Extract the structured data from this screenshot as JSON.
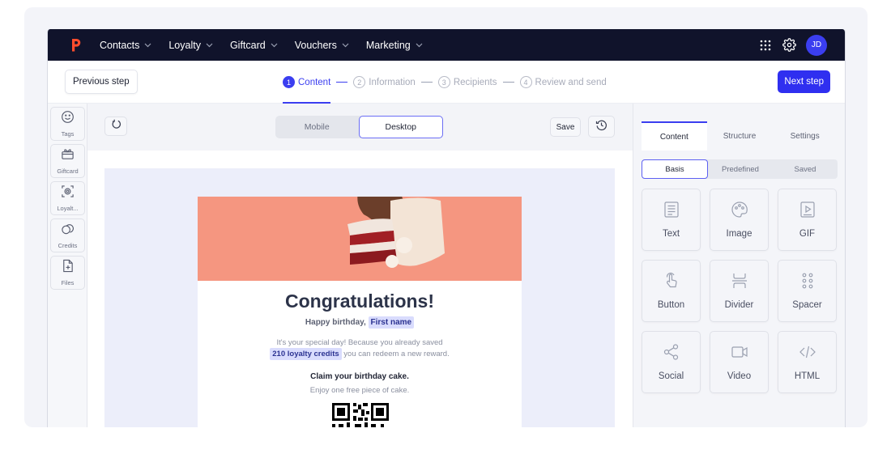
{
  "nav": {
    "items": [
      {
        "label": "Contacts"
      },
      {
        "label": "Loyalty"
      },
      {
        "label": "Giftcard"
      },
      {
        "label": "Vouchers"
      },
      {
        "label": "Marketing"
      }
    ],
    "avatar": "JD"
  },
  "stepbar": {
    "previous_label": "Previous step",
    "next_label": "Next step",
    "steps": [
      {
        "num": "1",
        "label": "Content"
      },
      {
        "num": "2",
        "label": "Information"
      },
      {
        "num": "3",
        "label": "Recipients"
      },
      {
        "num": "4",
        "label": "Review and send"
      }
    ]
  },
  "sidebar": {
    "items": [
      {
        "label": "Tags",
        "icon": "smiley-icon"
      },
      {
        "label": "Giftcard",
        "icon": "gift-icon"
      },
      {
        "label": "Loyalt...",
        "icon": "loyalty-scan-icon"
      },
      {
        "label": "Credits",
        "icon": "credits-icon"
      },
      {
        "label": "Files",
        "icon": "file-icon"
      }
    ]
  },
  "toolbar": {
    "view_options": [
      "Mobile",
      "Desktop"
    ],
    "save_label": "Save"
  },
  "email": {
    "heading": "Congratulations!",
    "greeting": "Happy birthday,",
    "first_name_tag": "First name",
    "message_line1": "It's your special day! Because you already saved",
    "credits_tag": "210 loyalty credits",
    "message_line2": "you can redeem a new reward.",
    "claim": "Claim your birthday cake.",
    "enjoy": "Enjoy one free piece of cake."
  },
  "panel": {
    "tabs": [
      "Content",
      "Structure",
      "Settings"
    ],
    "subtabs": [
      "Basis",
      "Predefined",
      "Saved"
    ],
    "blocks": [
      {
        "label": "Text",
        "icon": "text-icon"
      },
      {
        "label": "Image",
        "icon": "image-icon"
      },
      {
        "label": "GIF",
        "icon": "gif-icon"
      },
      {
        "label": "Button",
        "icon": "button-icon"
      },
      {
        "label": "Divider",
        "icon": "divider-icon"
      },
      {
        "label": "Spacer",
        "icon": "spacer-icon"
      },
      {
        "label": "Social",
        "icon": "share-icon"
      },
      {
        "label": "Video",
        "icon": "video-icon"
      },
      {
        "label": "HTML",
        "icon": "code-icon"
      }
    ]
  },
  "colors": {
    "nav_bg": "#10132b",
    "accent": "#3b3ef0",
    "logo": "#ff4d2d",
    "hero": "#f4907a"
  }
}
